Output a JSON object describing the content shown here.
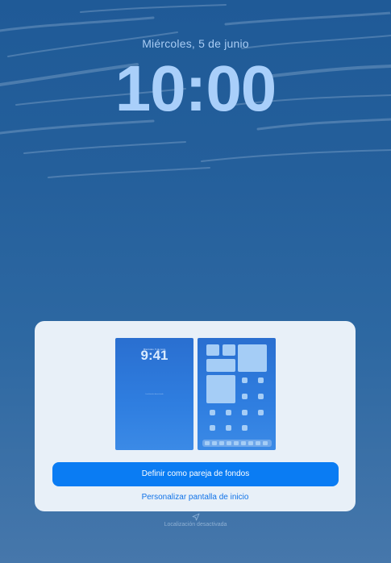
{
  "lock_screen": {
    "date": "Miércoles, 5 de junio",
    "time": "10:00"
  },
  "wallpaper_sheet": {
    "lock_preview": {
      "date": "Miércoles, 5 de junio",
      "time": "9:41",
      "location": "Localización desactivada"
    },
    "primary_button_label": "Definir como pareja de fondos",
    "secondary_link_label": "Personalizar pantalla de inicio"
  },
  "footer": {
    "location_icon": "location-arrow-icon",
    "location_status": "Localización desactivada"
  },
  "colors": {
    "accent": "#0a7cf3",
    "link": "#1173e8",
    "sheet_bg": "#e8f0f8"
  }
}
